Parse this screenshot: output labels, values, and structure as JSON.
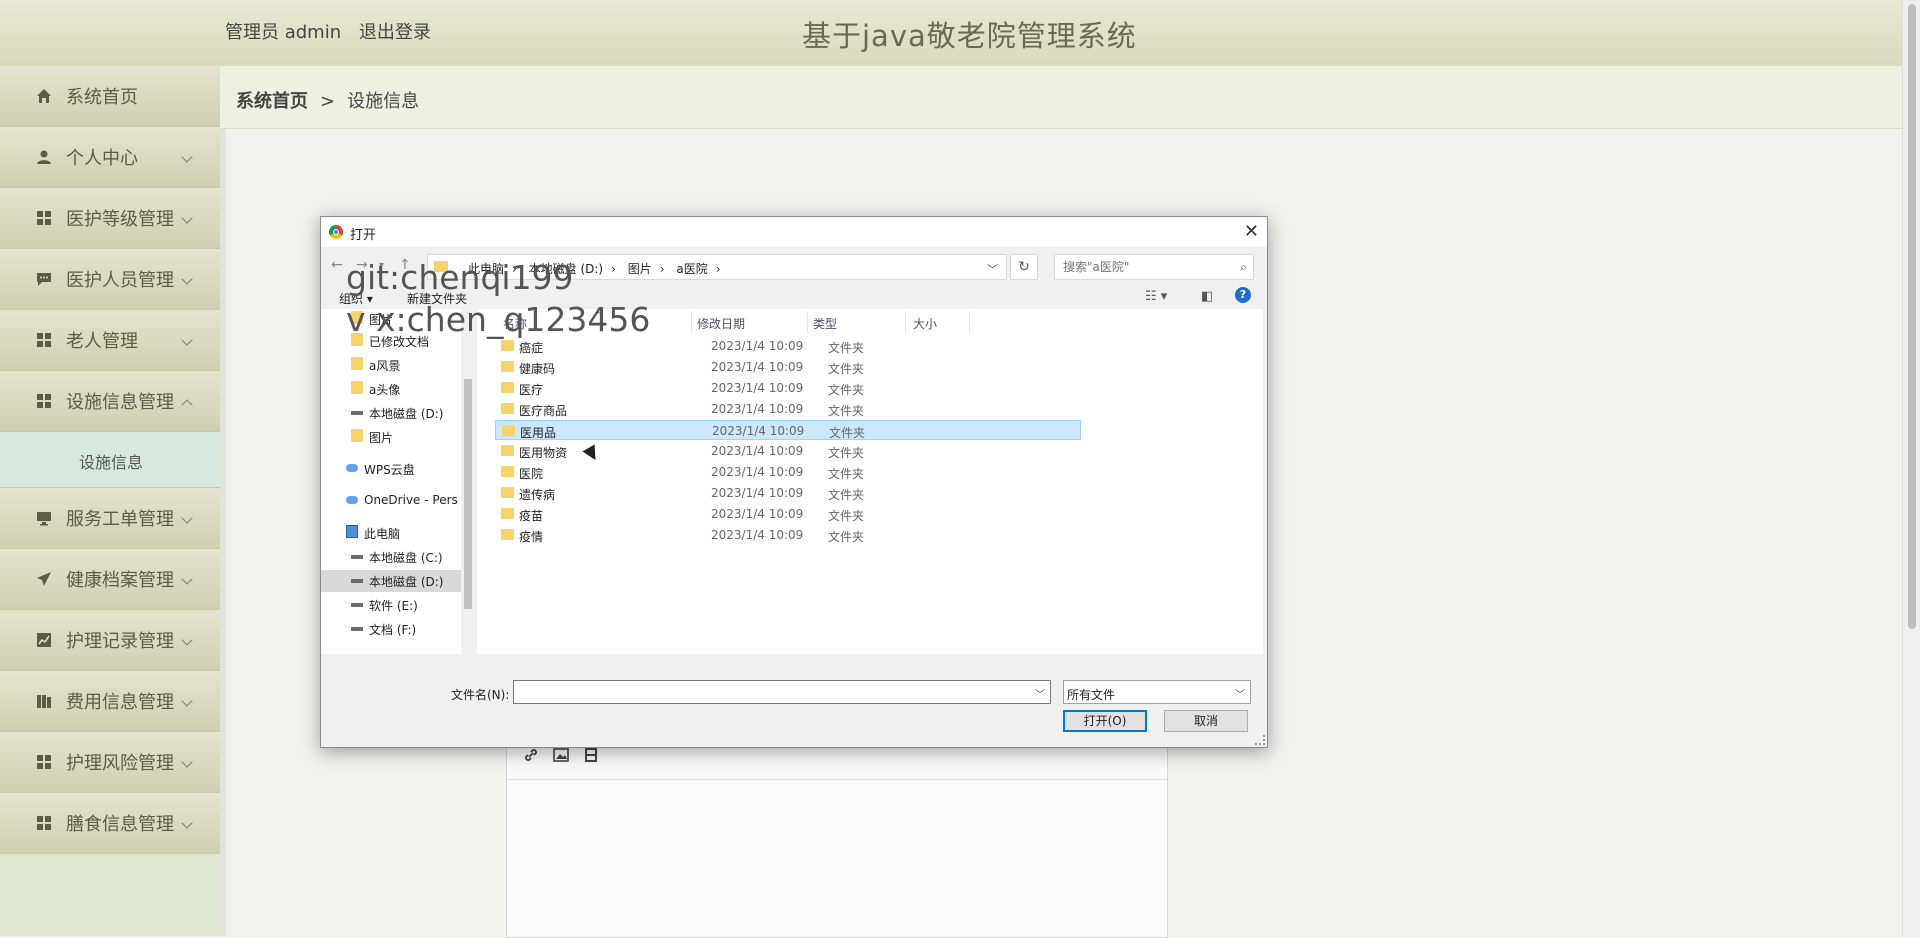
{
  "header": {
    "user_role": "管理员 admin",
    "logout_label": "退出登录",
    "system_title": "基于java敬老院管理系统"
  },
  "sidebar": {
    "items": [
      {
        "label": "系统首页",
        "icon": "home-icon"
      },
      {
        "label": "个人中心",
        "icon": "user-icon"
      },
      {
        "label": "医护等级管理",
        "icon": "grid-icon"
      },
      {
        "label": "医护人员管理",
        "icon": "chat-icon"
      },
      {
        "label": "老人管理",
        "icon": "grid-icon"
      },
      {
        "label": "设施信息管理",
        "icon": "grid-icon"
      },
      {
        "label": "服务工单管理",
        "icon": "monitor-icon"
      },
      {
        "label": "健康档案管理",
        "icon": "send-icon"
      },
      {
        "label": "护理记录管理",
        "icon": "chart-icon"
      },
      {
        "label": "费用信息管理",
        "icon": "book-icon"
      },
      {
        "label": "护理风险管理",
        "icon": "grid-icon"
      },
      {
        "label": "膳食信息管理",
        "icon": "grid-icon"
      }
    ],
    "submenu": {
      "label": "设施信息"
    }
  },
  "breadcrumb": {
    "home": "系统首页",
    "separator": ">",
    "current": "设施信息"
  },
  "dialog": {
    "title": "打开",
    "address_crumbs": [
      "此电脑",
      "本地磁盘 (D:)",
      "图片",
      "a医院"
    ],
    "search_placeholder": "搜索\"a医院\"",
    "organize_label": "组织 ▾",
    "new_folder_label": "新建文件夹",
    "nav_pane": [
      {
        "label": "图片",
        "type": "folder"
      },
      {
        "label": "已修改文档",
        "type": "folder"
      },
      {
        "label": "a风景",
        "type": "folder"
      },
      {
        "label": "a头像",
        "type": "folder"
      },
      {
        "label": "本地磁盘 (D:)",
        "type": "drive"
      },
      {
        "label": "图片",
        "type": "folder"
      },
      {
        "label": "WPS云盘",
        "type": "cloud"
      },
      {
        "label": "OneDrive - Pers",
        "type": "cloud"
      },
      {
        "label": "此电脑",
        "type": "pc"
      },
      {
        "label": "本地磁盘 (C:)",
        "type": "drive"
      },
      {
        "label": "本地磁盘 (D:)",
        "type": "drive",
        "selected": true
      },
      {
        "label": "软件 (E:)",
        "type": "drive"
      },
      {
        "label": "文档 (F:)",
        "type": "drive"
      }
    ],
    "columns": {
      "name": "名称",
      "date": "修改日期",
      "type": "类型",
      "size": "大小"
    },
    "files": [
      {
        "name": "癌症",
        "date": "2023/1/4 10:09",
        "type": "文件夹"
      },
      {
        "name": "健康码",
        "date": "2023/1/4 10:09",
        "type": "文件夹"
      },
      {
        "name": "医疗",
        "date": "2023/1/4 10:09",
        "type": "文件夹"
      },
      {
        "name": "医疗商品",
        "date": "2023/1/4 10:09",
        "type": "文件夹"
      },
      {
        "name": "医用品",
        "date": "2023/1/4 10:09",
        "type": "文件夹",
        "selected": true
      },
      {
        "name": "医用物资",
        "date": "2023/1/4 10:09",
        "type": "文件夹"
      },
      {
        "name": "医院",
        "date": "2023/1/4 10:09",
        "type": "文件夹"
      },
      {
        "name": "遗传病",
        "date": "2023/1/4 10:09",
        "type": "文件夹"
      },
      {
        "name": "疫苗",
        "date": "2023/1/4 10:09",
        "type": "文件夹"
      },
      {
        "name": "疫情",
        "date": "2023/1/4 10:09",
        "type": "文件夹"
      }
    ],
    "filename_label": "文件名(N):",
    "filename_value": "",
    "filetype_value": "所有文件",
    "open_label": "打开(O)",
    "cancel_label": "取消"
  },
  "watermark": {
    "line1": "git:chenqi199",
    "line2": "v x:chen_q123456"
  },
  "colors": {
    "header_bg": "#d9d9bd",
    "sidebar_bg": "#cfcfb2",
    "submenu_bg": "#d8e8e0",
    "selection": "#cce8ff",
    "primary_button_border": "#0078d7"
  }
}
